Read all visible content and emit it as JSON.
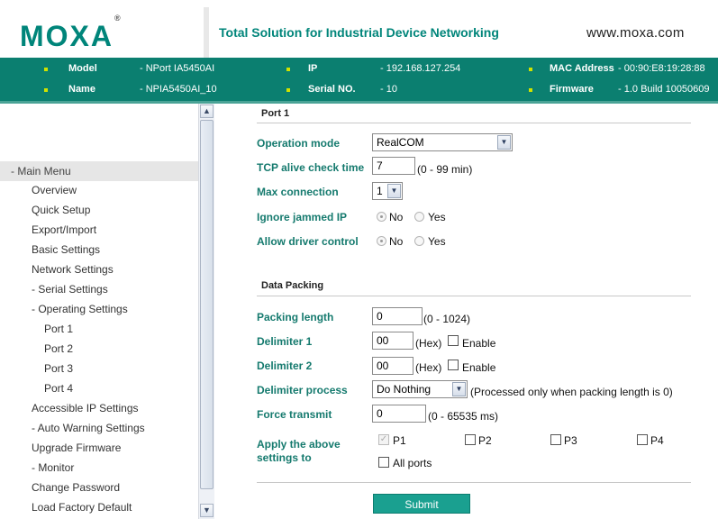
{
  "header": {
    "logo_text": "MOXA",
    "logo_mark": "®",
    "tagline": "Total Solution for Industrial Device Networking",
    "website": "www.moxa.com"
  },
  "info": {
    "model_label": "Model",
    "model_value": "- NPort IA5450AI",
    "name_label": "Name",
    "name_value": "- NPIA5450AI_10",
    "ip_label": "IP",
    "ip_value": "- 192.168.127.254",
    "serial_label": "Serial NO.",
    "serial_value": "- 10",
    "mac_label": "MAC Address",
    "mac_value": "- 00:90:E8:19:28:88",
    "firmware_label": "Firmware",
    "firmware_value": "- 1.0 Build 10050609"
  },
  "menu": {
    "title": "- Main Menu",
    "items": [
      "Overview",
      "Quick Setup",
      "Export/Import",
      "Basic Settings",
      "Network Settings",
      "- Serial Settings",
      "- Operating Settings",
      "Port 1",
      "Port 2",
      "Port 3",
      "Port 4",
      "Accessible IP Settings",
      "- Auto Warning Settings",
      "Upgrade Firmware",
      "- Monitor",
      "Change Password",
      "Load Factory Default"
    ]
  },
  "port": {
    "title": "Port 1",
    "operation_mode_label": "Operation mode",
    "operation_mode_value": "RealCOM",
    "tcp_alive_label": "TCP alive check time",
    "tcp_alive_value": "7",
    "tcp_alive_hint": "(0 - 99 min)",
    "max_conn_label": "Max connection",
    "max_conn_value": "1",
    "ignore_jammed_label": "Ignore jammed IP",
    "allow_driver_label": "Allow driver control",
    "no_label": "No",
    "yes_label": "Yes"
  },
  "packing": {
    "title": "Data Packing",
    "packing_length_label": "Packing length",
    "packing_length_value": "0",
    "packing_length_hint": "(0 - 1024)",
    "delim1_label": "Delimiter 1",
    "delim1_value": "00",
    "delim2_label": "Delimiter 2",
    "delim2_value": "00",
    "hex_label": "(Hex)",
    "enable_label": "Enable",
    "delim_process_label": "Delimiter process",
    "delim_process_value": "Do Nothing",
    "delim_process_hint": "(Processed only when packing length is 0)",
    "force_transmit_label": "Force transmit",
    "force_transmit_value": "0",
    "force_transmit_hint": "(0 - 65535 ms)",
    "apply_label_line1": "Apply the above",
    "apply_label_line2": "settings to",
    "p1": "P1",
    "p2": "P2",
    "p3": "P3",
    "p4": "P4",
    "all_ports": "All ports",
    "p1_checked": true
  },
  "submit_label": "Submit",
  "colors": {
    "brand": "#00857a",
    "infobar": "#0b7f70",
    "label": "#157a6e",
    "submit": "#1aa090"
  }
}
